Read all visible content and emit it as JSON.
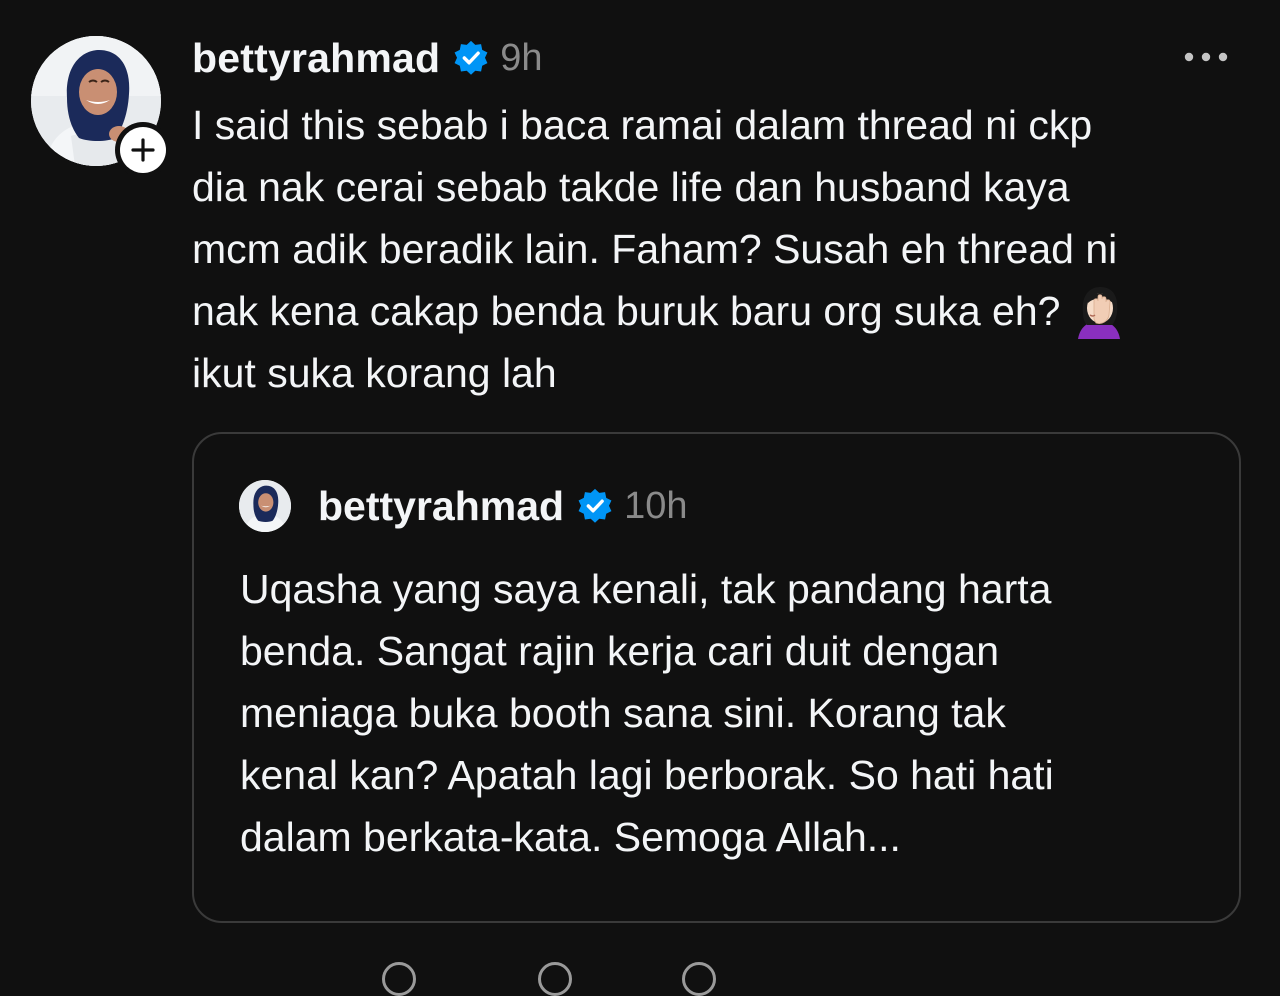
{
  "post": {
    "username": "bettyrahmad",
    "timestamp": "9h",
    "text_lines": [
      "I said this sebab i baca ramai dalam thread ni ckp",
      "dia nak cerai sebab takde life dan husband kaya",
      "mcm adik beradik lain. Faham? Susah eh thread ni",
      "nak kena cakap benda buruk baru org suka eh?",
      "ikut suka korang lah"
    ],
    "emoji": "woman-facepalming"
  },
  "quoted_post": {
    "username": "bettyrahmad",
    "timestamp": "10h",
    "text_lines": [
      "Uqasha yang saya kenali, tak pandang harta",
      "benda. Sangat rajin kerja cari duit dengan",
      "meniaga buka booth sana sini. Korang tak",
      "kenal kan? Apatah lagi berborak. So hati hati",
      "dalam berkata-kata. Semoga Allah..."
    ]
  },
  "icons": {
    "verified": "verified-badge-icon",
    "follow": "plus-icon",
    "more": "more-options-icon"
  },
  "colors": {
    "background": "#101010",
    "text": "#f3f5f7",
    "secondary_text": "#8a8a8a",
    "verified_blue": "#0095f6",
    "card_border": "#3a3a3a"
  }
}
